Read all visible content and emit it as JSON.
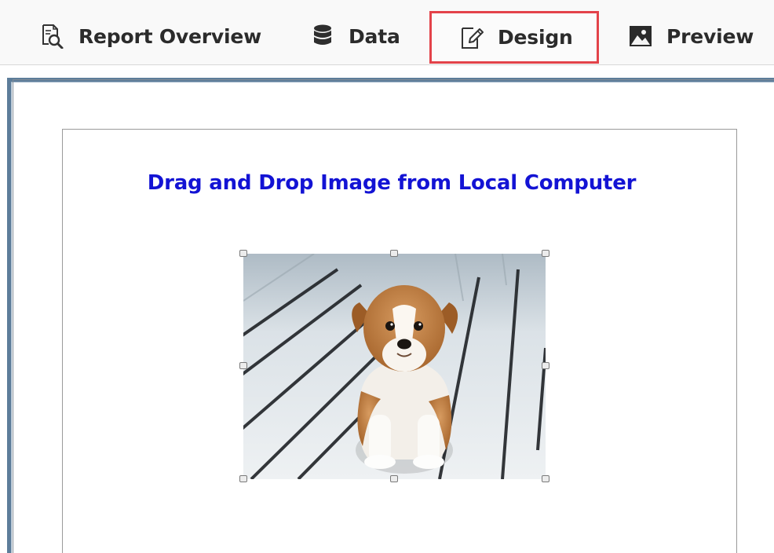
{
  "tabs": {
    "report_overview": {
      "label": "Report Overview",
      "icon": "report-overview-icon"
    },
    "data": {
      "label": "Data",
      "icon": "database-icon"
    },
    "design": {
      "label": "Design",
      "icon": "design-edit-icon",
      "selected": true
    },
    "preview": {
      "label": "Preview",
      "icon": "image-preview-icon"
    }
  },
  "canvas": {
    "title": "Drag and Drop Image from Local Computer",
    "image": {
      "subject": "puppy-image",
      "selected": true
    }
  },
  "colors": {
    "highlight_border": "#e3434a",
    "title_text": "#1313d4",
    "frame_border": "#5d7d9a"
  }
}
